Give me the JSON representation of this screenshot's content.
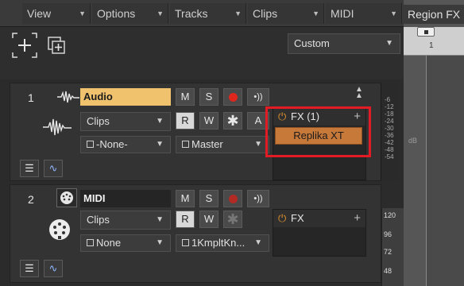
{
  "menubar": {
    "items": [
      {
        "label": "View"
      },
      {
        "label": "Options"
      },
      {
        "label": "Tracks"
      },
      {
        "label": "Clips"
      },
      {
        "label": "MIDI"
      },
      {
        "label": "Region FX"
      }
    ]
  },
  "toolbar": {
    "layout_preset": "Custom"
  },
  "timeline": {
    "bar_number": "1"
  },
  "tracks": [
    {
      "number": "1",
      "name": "Audio",
      "buttons": {
        "mute": "M",
        "solo": "S",
        "read": "R",
        "write": "W",
        "archive": "A"
      },
      "edit_filter": "Clips",
      "input": "-None-",
      "output": "Master",
      "fx": {
        "header": "FX (1)",
        "plugins": [
          "Replika XT"
        ]
      },
      "meter_labels": [
        "-6",
        "-12",
        "-18",
        "-24",
        "-30",
        "-36",
        "-42",
        "-48",
        "-54"
      ],
      "meter_db": "dB"
    },
    {
      "number": "2",
      "name": "MIDI",
      "buttons": {
        "mute": "M",
        "solo": "S",
        "read": "R",
        "write": "W"
      },
      "edit_filter": "Clips",
      "input": "None",
      "output": "1KmpltKn...",
      "fx": {
        "header": "FX",
        "plugins": []
      },
      "fader_values": [
        "120",
        "96",
        "72",
        "48"
      ]
    }
  ],
  "icons": {
    "add": "plus-icon",
    "add_track": "add-track-icon",
    "audio_waveform": "waveform-icon",
    "midi": "midi-connector-icon",
    "record": "record-icon",
    "input_echo": "input-echo-icon",
    "fx_power": "power-icon",
    "collapse": "collapse-icon"
  }
}
